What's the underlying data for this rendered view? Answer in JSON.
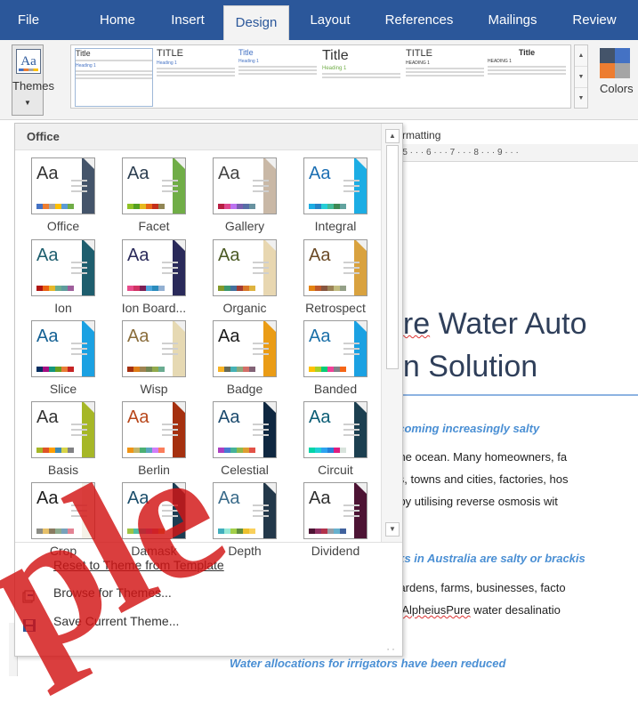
{
  "tabs": [
    {
      "label": "File"
    },
    {
      "label": "Home"
    },
    {
      "label": "Insert"
    },
    {
      "label": "Design"
    },
    {
      "label": "Layout"
    },
    {
      "label": "References"
    },
    {
      "label": "Mailings"
    },
    {
      "label": "Review"
    }
  ],
  "active_tab": "Design",
  "ribbon": {
    "themes_label": "Themes",
    "themes_icon_text": "Aa",
    "colors_label": "Colors",
    "doc_format_label": "Document Formatting",
    "doc_format_visible": "ent Formatting",
    "style_set": [
      {
        "title": "Title",
        "heading": "Heading 1"
      },
      {
        "title": "TITLE",
        "heading": "Heading 1"
      },
      {
        "title": "Title",
        "heading": "Heading 1"
      },
      {
        "title": "Title",
        "heading": "Heading 1"
      },
      {
        "title": "TITLE",
        "heading": "HEADING 1"
      },
      {
        "title": "Title",
        "heading": "HEADING 1"
      }
    ]
  },
  "panel": {
    "section_label": "Office",
    "themes": [
      {
        "name": "Office",
        "aa": "Aa",
        "text_color": "#333333",
        "decor": "#44546a",
        "swatches": [
          "#4472c4",
          "#ed7d31",
          "#a5a5a5",
          "#ffc000",
          "#5b9bd5",
          "#70ad47"
        ]
      },
      {
        "name": "Facet",
        "aa": "Aa",
        "text_color": "#2c3e50",
        "decor": "#70ad47",
        "swatches": [
          "#90c226",
          "#54a021",
          "#e6b91e",
          "#e76618",
          "#c42f1a",
          "#918655"
        ]
      },
      {
        "name": "Gallery",
        "aa": "Aa",
        "text_color": "#444444",
        "decor": "#c9b8a6",
        "swatches": [
          "#b71e42",
          "#de478e",
          "#bc72f0",
          "#795faf",
          "#586ea6",
          "#6892a0"
        ]
      },
      {
        "name": "Integral",
        "aa": "Aa",
        "text_color": "#1c6fb3",
        "decor": "#1cade4",
        "swatches": [
          "#1cade4",
          "#2683c6",
          "#27ced7",
          "#42ba97",
          "#3e8853",
          "#62a39f"
        ]
      },
      {
        "name": "Ion",
        "aa": "Aa",
        "text_color": "#1e5e6e",
        "decor": "#1e5e6e",
        "swatches": [
          "#b01513",
          "#ea6312",
          "#e6b729",
          "#6aac90",
          "#5f9c9d",
          "#9e5e9b"
        ]
      },
      {
        "name": "Ion Board...",
        "aa": "Aa",
        "text_color": "#2a2a5a",
        "decor": "#2a2a5a",
        "swatches": [
          "#e84c8b",
          "#d13264",
          "#7c1f55",
          "#4ea6dc",
          "#2b8cbd",
          "#93b0d2"
        ]
      },
      {
        "name": "Organic",
        "aa": "Aa",
        "text_color": "#4b5a24",
        "decor": "#e8d7b1",
        "swatches": [
          "#83992a",
          "#3c9770",
          "#44709d",
          "#a23c33",
          "#d97828",
          "#deb340"
        ]
      },
      {
        "name": "Retrospect",
        "aa": "Aa",
        "text_color": "#6b4a27",
        "decor": "#d9a23f",
        "swatches": [
          "#e48312",
          "#bd582c",
          "#865640",
          "#9b8357",
          "#c2bc80",
          "#94a088"
        ]
      },
      {
        "name": "Slice",
        "aa": "Aa",
        "text_color": "#146194",
        "decor": "#1ba1e2",
        "swatches": [
          "#052f61",
          "#a50e82",
          "#14967c",
          "#6a9e1f",
          "#e87d37",
          "#c62324"
        ]
      },
      {
        "name": "Wisp",
        "aa": "Aa",
        "text_color": "#8a6d3b",
        "decor": "#e6d9b3",
        "swatches": [
          "#a53010",
          "#de7e18",
          "#9f8351",
          "#728653",
          "#92aa4c",
          "#6aac91"
        ]
      },
      {
        "name": "Badge",
        "aa": "Aa",
        "text_color": "#1b1b1b",
        "decor": "#ea9c16",
        "swatches": [
          "#f8b323",
          "#656a59",
          "#46b2b5",
          "#8caa7e",
          "#d36f68",
          "#826276"
        ]
      },
      {
        "name": "Banded",
        "aa": "Aa",
        "text_color": "#1a6fa8",
        "decor": "#1ba1e2",
        "swatches": [
          "#ffc000",
          "#a5d028",
          "#08cc78",
          "#f24099",
          "#828288",
          "#f56617"
        ]
      },
      {
        "name": "Basis",
        "aa": "Aa",
        "text_color": "#333333",
        "decor": "#a6b727",
        "swatches": [
          "#a6b727",
          "#df5327",
          "#fe9e00",
          "#418ab3",
          "#d7d447",
          "#818183"
        ]
      },
      {
        "name": "Berlin",
        "aa": "Aa",
        "text_color": "#b8471b",
        "decor": "#a5300f",
        "swatches": [
          "#f09415",
          "#c1b56b",
          "#4baf73",
          "#5aa6c0",
          "#d17df9",
          "#fa7e5c"
        ]
      },
      {
        "name": "Celestial",
        "aa": "Aa",
        "text_color": "#1b4a6e",
        "decor": "#0f2740",
        "swatches": [
          "#ac3ec1",
          "#477bd1",
          "#46b298",
          "#90ba4c",
          "#dd9d31",
          "#e25247"
        ]
      },
      {
        "name": "Circuit",
        "aa": "Aa",
        "text_color": "#0b5d75",
        "decor": "#1c3f50",
        "swatches": [
          "#03d4a8",
          "#21d0d6",
          "#2ea3ef",
          "#2680d9",
          "#df1d80",
          "#d8e3dc"
        ]
      },
      {
        "name": "Crop",
        "aa": "Aa",
        "text_color": "#1e1e1e",
        "decor": "#f5f2e8",
        "swatches": [
          "#8c8d86",
          "#e6c069",
          "#897b61",
          "#8dab8e",
          "#77a2bb",
          "#e28394"
        ]
      },
      {
        "name": "Damask",
        "aa": "Aa",
        "text_color": "#1c4e6b",
        "decor": "#1c3d53",
        "swatches": [
          "#9ec544",
          "#50bea3",
          "#4a9ccc",
          "#9a66ca",
          "#c6607b",
          "#e8973c"
        ]
      },
      {
        "name": "Depth",
        "aa": "Aa",
        "text_color": "#3a6b8a",
        "decor": "#23384a",
        "swatches": [
          "#41aebd",
          "#97e9d5",
          "#a2cf49",
          "#608f3d",
          "#edc12e",
          "#f9d05b"
        ]
      },
      {
        "name": "Dividend",
        "aa": "Aa",
        "text_color": "#2f2f2f",
        "decor": "#4d1434",
        "swatches": [
          "#4d1434",
          "#903163",
          "#b2324b",
          "#969fa7",
          "#66b1ce",
          "#40619d"
        ]
      }
    ],
    "menu_items": [
      {
        "label": "Reset to Theme from Template",
        "icon": "none"
      },
      {
        "label": "Browse for Themes...",
        "icon": "folder-icon"
      },
      {
        "label": "Save Current Theme...",
        "icon": "save-icon"
      }
    ]
  },
  "document": {
    "ruler_text": "· · · 5 · · · 6 · · · 7 · · · 8 · · · 9 · · ·",
    "title_line1_pre": "",
    "title_line1_squig": "ure",
    "title_line1_rest": " Water Auto",
    "title_line2": "on Solution",
    "heading1": "ecoming increasingly salty",
    "para1": [
      "n the ocean. Many homeowners, fa",
      "ses, towns and cities, factories, hos",
      "nt by utilising reverse osmosis wit"
    ],
    "heading2": "eks in Australia are salty or brackis",
    "para2_line1": ", gardens, farms, businesses, facto",
    "para2_line2_pre": "an ",
    "para2_line2_squig": "AlpheiusPure",
    "para2_line2_post": " water desalinatio",
    "heading3": "Water allocations for irrigators have been reduced"
  },
  "watermark_text": "ple",
  "colors": {
    "accent": "#2b579a",
    "heading_blue": "#4a8fd4",
    "watermark_red": "#d21414"
  }
}
